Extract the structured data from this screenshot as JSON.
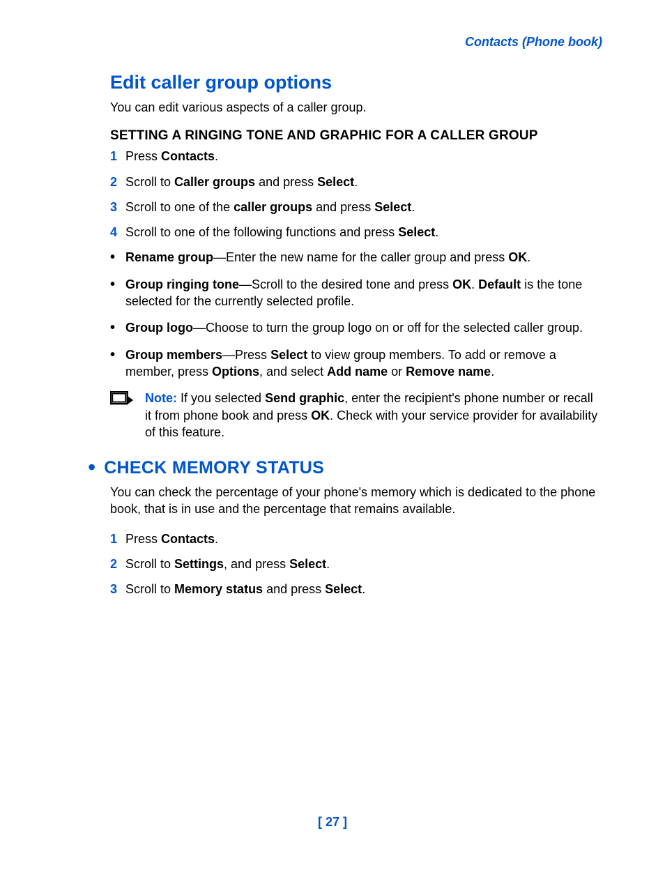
{
  "header": {
    "section": "Contacts (Phone book)"
  },
  "s1": {
    "title": "Edit caller group options",
    "intro": "You can edit various aspects of a caller group.",
    "subhead": "SETTING A RINGING TONE AND GRAPHIC FOR A CALLER GROUP",
    "steps": {
      "n1": "1",
      "t1a": "Press ",
      "t1b": "Contacts",
      "t1c": ".",
      "n2": "2",
      "t2a": "Scroll to ",
      "t2b": "Caller groups",
      "t2c": " and press ",
      "t2d": "Select",
      "t2e": ".",
      "n3": "3",
      "t3a": "Scroll to one of the ",
      "t3b": "caller groups",
      "t3c": " and press ",
      "t3d": "Select",
      "t3e": ".",
      "n4": "4",
      "t4a": "Scroll to one of the following functions and press ",
      "t4b": "Select",
      "t4c": "."
    },
    "bullets": {
      "b1a": "Rename group",
      "b1b": "—Enter the new name for the caller group and press ",
      "b1c": "OK",
      "b1d": ".",
      "b2a": "Group ringing tone",
      "b2b": "—Scroll to the desired tone and press ",
      "b2c": "OK",
      "b2d": ". ",
      "b2e": "Default",
      "b2f": " is the tone selected for the currently selected profile.",
      "b3a": "Group logo",
      "b3b": "—Choose to turn the group logo on or off for the selected caller group.",
      "b4a": "Group members",
      "b4b": "—Press ",
      "b4c": "Select",
      "b4d": " to view group members. To add or remove a member, press ",
      "b4e": "Options",
      "b4f": ", and select ",
      "b4g": "Add name",
      "b4h": " or ",
      "b4i": "Remove name",
      "b4j": "."
    },
    "note": {
      "label": "Note:",
      "a": " If you selected ",
      "b": "Send graphic",
      "c": ", enter the recipient's phone number or recall it from phone book and press ",
      "d": "OK",
      "e": ". Check with your service provider for availability of this feature."
    }
  },
  "s2": {
    "title": "CHECK MEMORY STATUS",
    "intro": "You can check the percentage of your phone's memory which is dedicated to the phone book, that is in use and the percentage that remains available.",
    "steps": {
      "n1": "1",
      "t1a": "Press ",
      "t1b": "Contacts",
      "t1c": ".",
      "n2": "2",
      "t2a": "Scroll to ",
      "t2b": "Settings",
      "t2c": ", and press ",
      "t2d": "Select",
      "t2e": ".",
      "n3": "3",
      "t3a": "Scroll to ",
      "t3b": "Memory status",
      "t3c": " and press ",
      "t3d": "Select",
      "t3e": "."
    }
  },
  "pagenum": "[ 27 ]"
}
